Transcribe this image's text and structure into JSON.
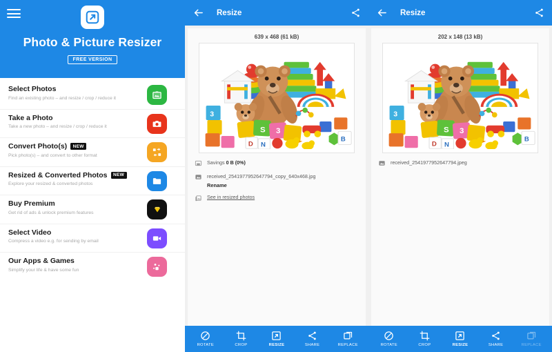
{
  "sidebar": {
    "menu_icon": "hamburger-menu-icon",
    "logo_icon": "app-logo-resize-icon",
    "app_title": "Photo & Picture Resizer",
    "badge": "FREE VERSION",
    "header_color": "#1e88e5",
    "items": [
      {
        "title": "Select Photos",
        "subtitle": "Find an existing photo – and resize / crop / reduce it",
        "badge": "",
        "icon": "gallery-icon",
        "icon_color": "#2cb742"
      },
      {
        "title": "Take a Photo",
        "subtitle": "Take a new photo – and resize / crop / reduce it",
        "badge": "",
        "icon": "camera-icon",
        "icon_color": "#e8341c"
      },
      {
        "title": "Convert Photo(s)",
        "subtitle": "Pick photo(s) – and convert to other format",
        "badge": "NEW",
        "icon": "convert-icon",
        "icon_color": "#f5a623"
      },
      {
        "title": "Resized & Converted Photos",
        "subtitle": "Explore your resized & converted photos",
        "badge": "NEW",
        "icon": "folder-icon",
        "icon_color": "#1e88e5"
      },
      {
        "title": "Buy Premium",
        "subtitle": "Get rid of ads & unlock premium features",
        "badge": "",
        "icon": "diamond-icon",
        "icon_color": "#101010"
      },
      {
        "title": "Select Video",
        "subtitle": "Compress a video e.g. for sending by email",
        "badge": "",
        "icon": "video-icon",
        "icon_color": "#7c4dff"
      },
      {
        "title": "Our Apps & Games",
        "subtitle": "Simplify your life & have some fun",
        "badge": "",
        "icon": "apps-icon",
        "icon_color": "#ec6a9b"
      }
    ]
  },
  "middle_panel": {
    "back_icon": "back-arrow-icon",
    "title": "Resize",
    "share_icon": "share-icon",
    "dimensions": "639 x 468 (61 kB)",
    "savings_icon": "savings-icon",
    "savings_label": "Savings",
    "savings_value": "0 B (0%)",
    "file_icon": "image-file-icon",
    "filename": "received_2541977952647794_copy_640x468.jpg",
    "rename_label": "Rename",
    "see_icon": "gallery-photos-icon",
    "see_label": "See in resized photos",
    "toolbar": [
      {
        "label": "ROTATE",
        "icon": "rotate-icon",
        "active": false,
        "disabled": false
      },
      {
        "label": "CROP",
        "icon": "crop-icon",
        "active": false,
        "disabled": false
      },
      {
        "label": "RESIZE",
        "icon": "resize-icon",
        "active": true,
        "disabled": false
      },
      {
        "label": "SHARE",
        "icon": "share-icon",
        "active": false,
        "disabled": false
      },
      {
        "label": "REPLACE",
        "icon": "replace-icon",
        "active": false,
        "disabled": false
      }
    ]
  },
  "right_panel": {
    "back_icon": "back-arrow-icon",
    "title": "Resize",
    "share_icon": "share-icon",
    "dimensions": "202 x 148 (13 kB)",
    "file_icon": "image-file-icon",
    "filename": "received_2541977952647794.jpeg",
    "toolbar": [
      {
        "label": "ROTATE",
        "icon": "rotate-icon",
        "active": false,
        "disabled": false
      },
      {
        "label": "CROP",
        "icon": "crop-icon",
        "active": false,
        "disabled": false
      },
      {
        "label": "RESIZE",
        "icon": "resize-icon",
        "active": true,
        "disabled": false
      },
      {
        "label": "SHARE",
        "icon": "share-icon",
        "active": false,
        "disabled": false
      },
      {
        "label": "REPLACE",
        "icon": "replace-icon",
        "active": false,
        "disabled": true
      }
    ]
  },
  "photo": {
    "description": "colorful children toys with teddy bear, blocks, stacking rings, puzzle mat"
  }
}
